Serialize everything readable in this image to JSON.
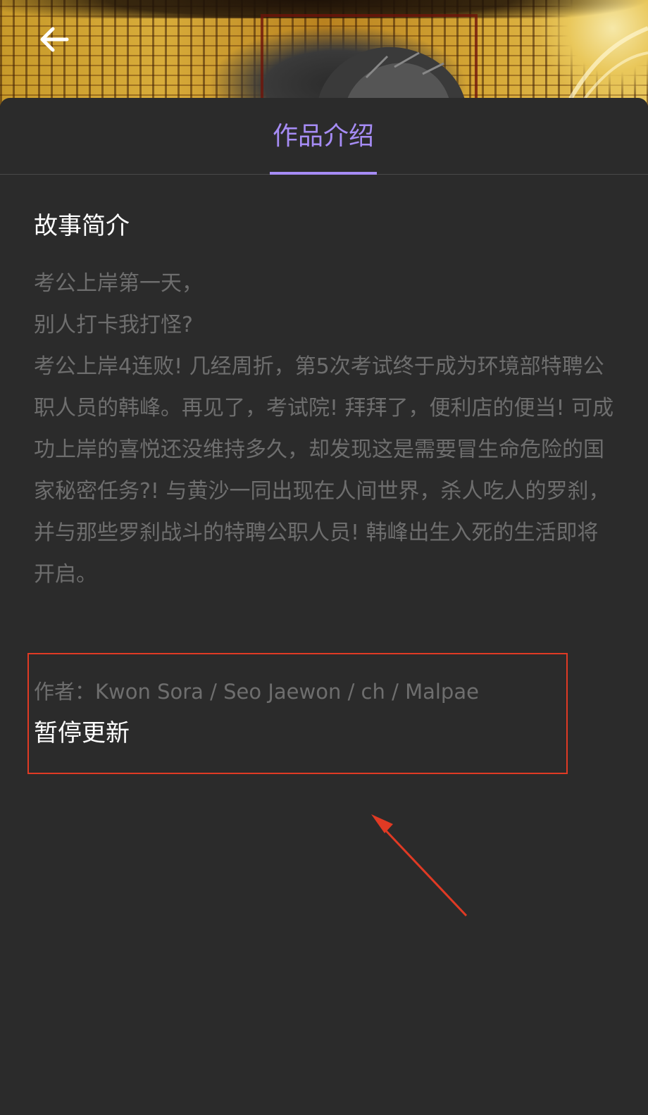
{
  "header": {
    "back_icon": "arrow-left-icon",
    "cover_alt": "cover art"
  },
  "tabs": [
    {
      "label": "作品介绍",
      "active": true
    }
  ],
  "synopsis": {
    "title": "故事简介",
    "lines": [
      "考公上岸第一天，",
      "别人打卡我打怪?",
      "考公上岸4连败! 几经周折，第5次考试终于成为环境部特聘公职人员的韩峰。再见了，考试院! 拜拜了，便利店的便当! 可成功上岸的喜悦还没维持多久，却发现这是需要冒生命危险的国家秘密任务?! 与黄沙一同出现在人间世界，杀人吃人的罗刹，并与那些罗刹战斗的特聘公职人员! 韩峰出生入死的生活即将开启。"
    ]
  },
  "meta": {
    "author": "作者：Kwon Sora / Seo Jaewon / ch / Malpae",
    "status": "暂停更新"
  },
  "colors": {
    "accent": "#a68cf5",
    "background": "#2b2b2b",
    "annotation": "#e03a24"
  }
}
